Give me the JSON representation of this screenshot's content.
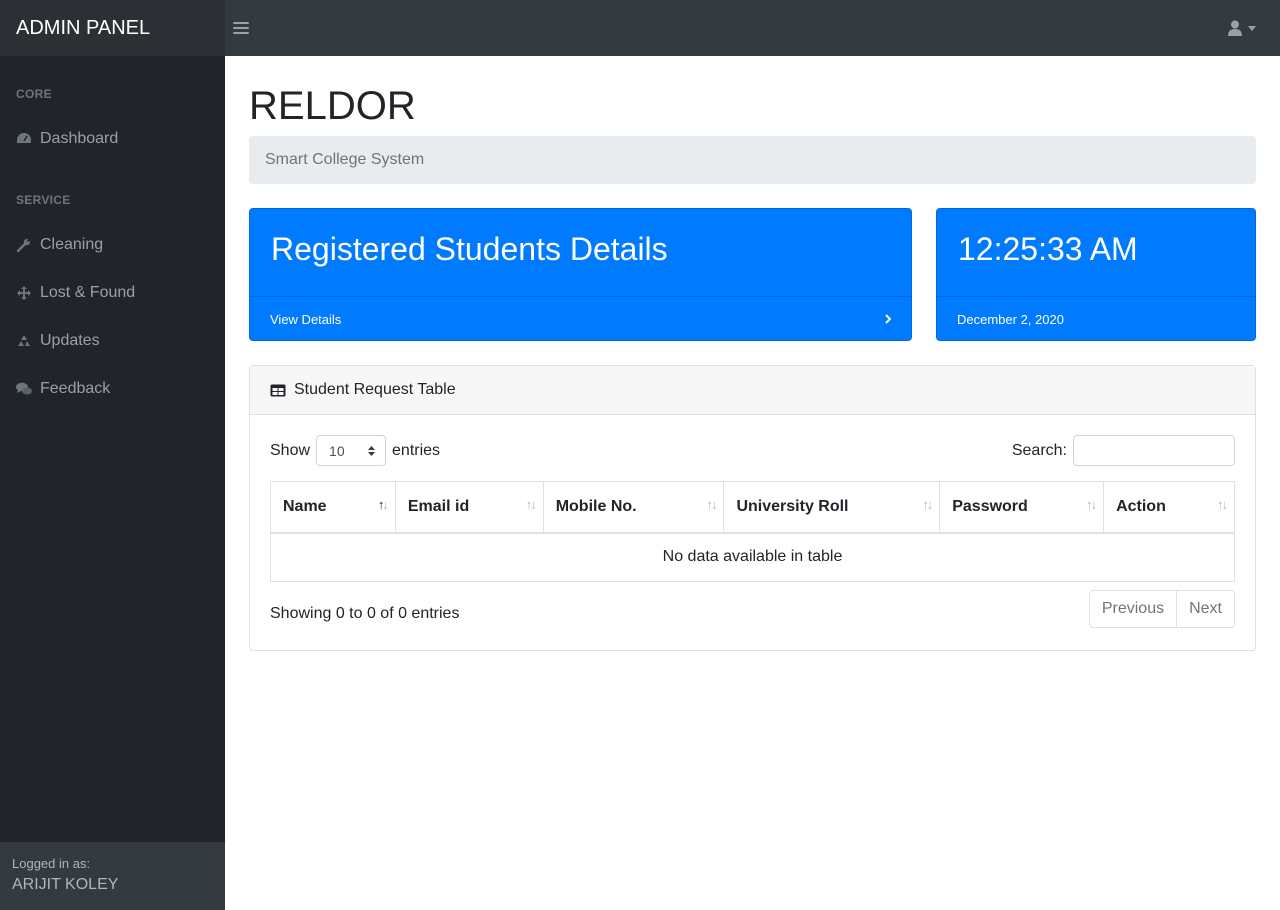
{
  "brand": "ADMIN PANEL",
  "sidebar": {
    "headings": [
      "CORE",
      "SERVICE"
    ],
    "items": [
      {
        "label": "Dashboard",
        "icon": "tachometer-icon"
      },
      {
        "label": "Cleaning",
        "icon": "wrench-icon"
      },
      {
        "label": "Lost & Found",
        "icon": "arrows-icon"
      },
      {
        "label": "Updates",
        "icon": "recycle-icon"
      },
      {
        "label": "Feedback",
        "icon": "comments-icon"
      }
    ],
    "footer": {
      "label": "Logged in as:",
      "user": "ARIJIT KOLEY"
    }
  },
  "page": {
    "title": "RELDOR",
    "breadcrumb": "Smart College System"
  },
  "cards": {
    "students": {
      "title": "Registered Students Details",
      "link": "View Details"
    },
    "clock": {
      "time": "12:25:33 AM",
      "date": "December 2, 2020"
    }
  },
  "table": {
    "header": "Student Request Table",
    "show_label": "Show",
    "entries_value": "10",
    "entries_label": "entries",
    "search_label": "Search:",
    "columns": [
      "Name",
      "Email id",
      "Mobile No.",
      "University Roll",
      "Password",
      "Action"
    ],
    "empty": "No data available in table",
    "info": "Showing 0 to 0 of 0 entries",
    "previous": "Previous",
    "next": "Next"
  },
  "colors": {
    "primary": "#007bff",
    "sidebar": "#212529",
    "navbar": "#343a40"
  }
}
